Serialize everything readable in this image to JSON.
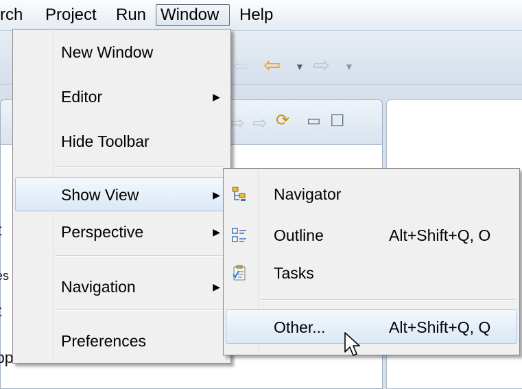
{
  "menubar": {
    "items": [
      "rch",
      "Project",
      "Run",
      "Window",
      "Help"
    ]
  },
  "toolbar": {
    "icons": [
      "back-faded-icon",
      "back-arrow-icon",
      "forward-arrow-icon"
    ]
  },
  "background": {
    "fragments": [
      "t",
      "es",
      "t",
      "pp r"
    ]
  },
  "window_menu": {
    "items": [
      {
        "label": "New Window",
        "submenu": false
      },
      {
        "label": "Editor",
        "submenu": true
      },
      {
        "label": "Hide Toolbar",
        "submenu": false
      },
      {
        "label": "Show View",
        "submenu": true,
        "highlighted": true
      },
      {
        "label": "Perspective",
        "submenu": true
      },
      {
        "label": "Navigation",
        "submenu": true
      },
      {
        "label": "Preferences",
        "submenu": false
      }
    ]
  },
  "show_view_menu": {
    "items": [
      {
        "label": "Navigator",
        "accelerator": "",
        "icon": "navigator-icon"
      },
      {
        "label": "Outline",
        "accelerator": "Alt+Shift+Q, O",
        "icon": "outline-icon"
      },
      {
        "label": "Tasks",
        "accelerator": "",
        "icon": "tasks-icon"
      },
      {
        "label": "Other...",
        "accelerator": "Alt+Shift+Q, Q",
        "highlighted": true
      }
    ]
  },
  "colors": {
    "menu_background": "#f0f0f0",
    "highlight_fill": "#dbe8f6",
    "highlight_border": "#a9c4e4",
    "menubar_background": "#e4ebf3"
  }
}
